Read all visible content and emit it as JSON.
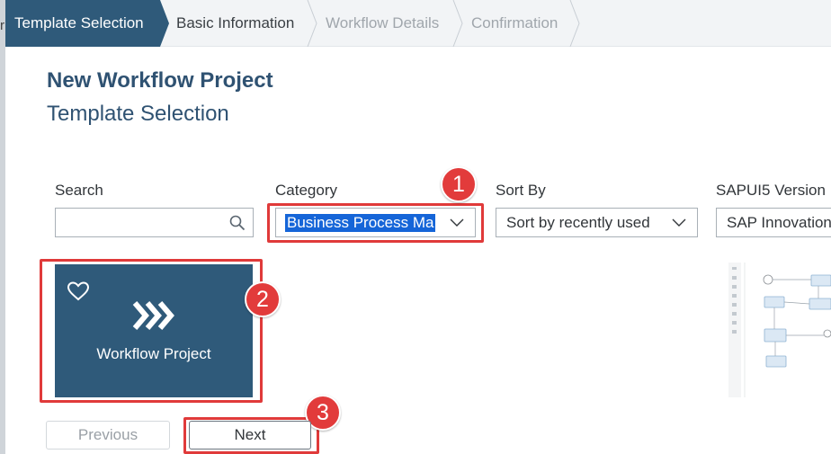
{
  "wizard": {
    "steps": [
      {
        "label": "Template Selection"
      },
      {
        "label": "Basic Information"
      },
      {
        "label": "Workflow Details"
      },
      {
        "label": "Confirmation"
      }
    ]
  },
  "left_strip": {
    "text": "r"
  },
  "header": {
    "title": "New Workflow Project",
    "subtitle": "Template Selection"
  },
  "filters": {
    "search": {
      "label": "Search",
      "value": ""
    },
    "category": {
      "label": "Category",
      "value": "Business Process Ma"
    },
    "sort": {
      "label": "Sort By",
      "value": "Sort by recently used"
    },
    "version": {
      "label": "SAPUI5 Version",
      "value": "SAP Innovation"
    }
  },
  "tile": {
    "label": "Workflow Project",
    "icon": "chevrons-icon"
  },
  "markers": [
    "1",
    "2",
    "3"
  ],
  "buttons": {
    "previous": "Previous",
    "next": "Next"
  },
  "colors": {
    "accent": "#2f5a7a",
    "highlight": "#e03a3a",
    "selection": "#1565d8"
  }
}
